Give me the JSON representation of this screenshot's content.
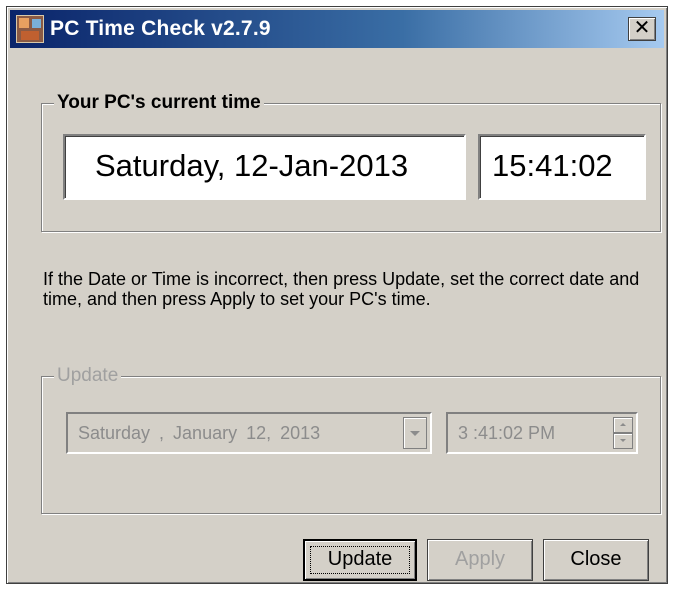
{
  "window": {
    "title": "PC Time Check  v2.7.9",
    "close_glyph": "✕"
  },
  "current_time": {
    "legend": "Your PC's current time",
    "date": "Saturday, 12-Jan-2013",
    "time": "15:41:02"
  },
  "info": {
    "text": "If the Date or Time is incorrect, then press Update, set the correct date and time, and then press Apply to set your PC's time."
  },
  "update_group": {
    "legend": "Update",
    "date_picker_value": "Saturday  ,  January   12, 2013",
    "time_picker_value": "3 :41:02 PM"
  },
  "buttons": {
    "update": "Update",
    "apply": "Apply",
    "close": "Close"
  },
  "colors": {
    "dialog_background": "#d4d0c8",
    "titlebar_start": "#0a246a",
    "titlebar_end": "#a6caf0",
    "disabled_text": "#8c8c8c"
  },
  "icons": {
    "app": "app-icon",
    "close": "close-icon",
    "dropdown": "chevron-down-icon",
    "spin_up": "spin-up-icon",
    "spin_down": "spin-down-icon"
  }
}
